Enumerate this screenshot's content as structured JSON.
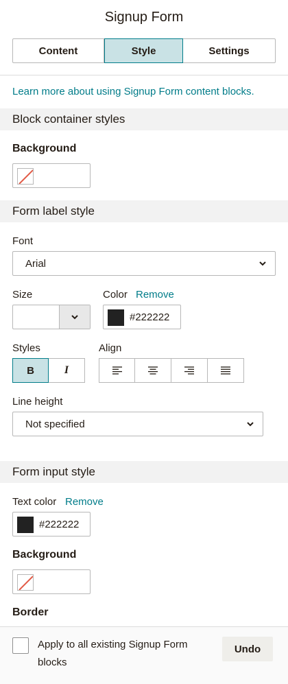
{
  "panel": {
    "title": "Signup Form"
  },
  "tabs": [
    {
      "label": "Content",
      "active": false
    },
    {
      "label": "Style",
      "active": true
    },
    {
      "label": "Settings",
      "active": false
    }
  ],
  "learn_more": "Learn more about using Signup Form content blocks.",
  "block_container": {
    "header": "Block container styles",
    "background_label": "Background",
    "background_value": "none"
  },
  "form_label": {
    "header": "Form label style",
    "font_label": "Font",
    "font_value": "Arial",
    "size_label": "Size",
    "size_value": "",
    "color_label": "Color",
    "color_remove": "Remove",
    "color_value": "#222222",
    "styles_label": "Styles",
    "bold_glyph": "B",
    "italic_glyph": "I",
    "bold_active": true,
    "align_label": "Align",
    "align_options": [
      "align-left",
      "align-center",
      "align-right",
      "align-justify"
    ],
    "line_height_label": "Line height",
    "line_height_value": "Not specified"
  },
  "form_input": {
    "header": "Form input style",
    "text_color_label": "Text color",
    "text_color_remove": "Remove",
    "text_color_value": "#222222",
    "background_label": "Background",
    "background_value": "none",
    "border_label": "Border"
  },
  "footer": {
    "apply_label": "Apply to all existing Signup Form blocks",
    "apply_checked": false,
    "undo_label": "Undo"
  },
  "colors": {
    "accent": "#007c89",
    "active_tab_bg": "#c9e2e5",
    "section_bg": "#f2f2f2",
    "swatch_dark": "#222222",
    "no_color_slash": "#e25b47"
  },
  "icons": {
    "chevron": "chevron-down-icon",
    "no_color": "no-color-icon"
  }
}
